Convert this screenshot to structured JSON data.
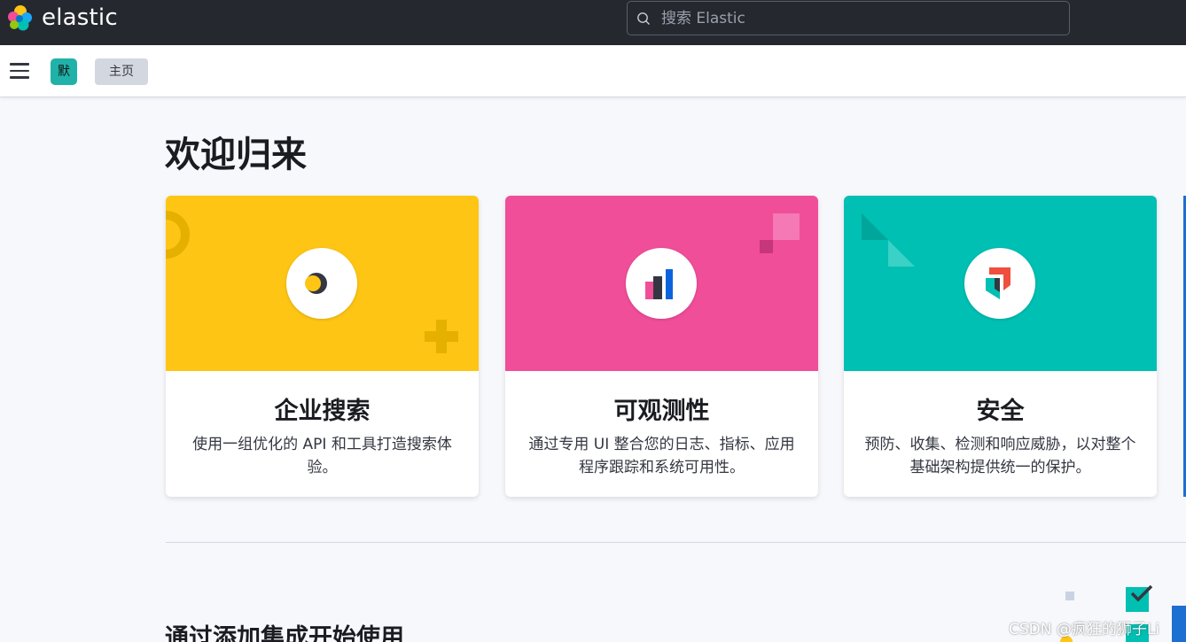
{
  "header": {
    "brand": "elastic",
    "search_placeholder": "搜索 Elastic"
  },
  "subheader": {
    "space_avatar": "默",
    "breadcrumb": "主页"
  },
  "main": {
    "title": "欢迎归来",
    "cards": [
      {
        "title": "企业搜索",
        "description": "使用一组优化的 API 和工具打造搜索体验。",
        "color": "#fec514"
      },
      {
        "title": "可观测性",
        "description": "通过专用 UI 整合您的日志、指标、应用程序跟踪和系统可用性。",
        "color": "#f04e98"
      },
      {
        "title": "安全",
        "description": "预防、收集、检测和响应威胁，以对整个基础架构提供统一的保护。",
        "color": "#00bfb3"
      }
    ],
    "section_title": "通过添加集成开始使用"
  },
  "watermark": "CSDN @疯狂的狮子Li",
  "colors": {
    "header_bg": "#25282f",
    "accent_teal": "#00bfb3",
    "accent_pink": "#f04e98",
    "accent_yellow": "#fec514",
    "accent_blue": "#1d6fd1"
  }
}
